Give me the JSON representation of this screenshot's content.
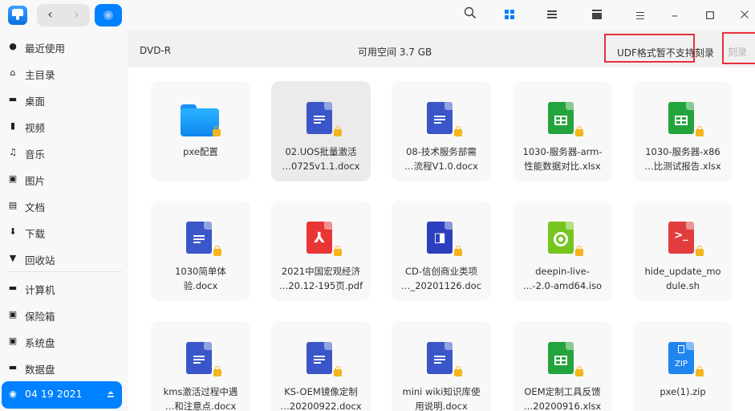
{
  "window": {
    "nav_back": "‹",
    "nav_forward": "›",
    "search_icon": "⌕",
    "minimize": "–",
    "maximize": "☐",
    "close": "✕"
  },
  "sidebar": {
    "items": [
      {
        "label": "最近使用",
        "icon": "clock-icon"
      },
      {
        "label": "主目录",
        "icon": "home-icon"
      },
      {
        "label": "桌面",
        "icon": "desktop-icon"
      },
      {
        "label": "视频",
        "icon": "video-icon"
      },
      {
        "label": "音乐",
        "icon": "music-icon"
      },
      {
        "label": "图片",
        "icon": "picture-icon"
      },
      {
        "label": "文档",
        "icon": "document-icon"
      },
      {
        "label": "下载",
        "icon": "download-icon"
      },
      {
        "label": "回收站",
        "icon": "trash-icon"
      },
      {
        "label": "计算机",
        "icon": "computer-icon"
      },
      {
        "label": "保险箱",
        "icon": "vault-icon"
      },
      {
        "label": "系统盘",
        "icon": "system-disk-icon"
      },
      {
        "label": "数据盘",
        "icon": "data-disk-icon"
      },
      {
        "label": "04 19 2021",
        "icon": "disc-icon"
      }
    ]
  },
  "infobar": {
    "disc_type": "DVD-R",
    "free_space": "可用空间 3.7 GB",
    "warning": "UDF格式暂不支持刻录",
    "burn_button": "刻录"
  },
  "files": [
    {
      "line1": "pxe配置",
      "line2": "",
      "type": "folder"
    },
    {
      "line1": "02.UOS批量激活",
      "line2": "…0725v1.1.docx",
      "type": "doc"
    },
    {
      "line1": "08-技术服务部需",
      "line2": "…流程V1.0.docx",
      "type": "doc"
    },
    {
      "line1": "1030-服务器-arm-",
      "line2": "性能数据对比.xlsx",
      "type": "xls"
    },
    {
      "line1": "1030-服务器-x86",
      "line2": "…比测试报告.xlsx",
      "type": "xls"
    },
    {
      "line1": "1030简单体",
      "line2": "验.docx",
      "type": "doc"
    },
    {
      "line1": "2021中国宏观经济",
      "line2": "…20.12-195页.pdf",
      "type": "pdf"
    },
    {
      "line1": "CD-信创商业类项",
      "line2": "…_20201126.doc",
      "type": "wps"
    },
    {
      "line1": "deepin-live-",
      "line2": "…-2.0-amd64.iso",
      "type": "iso"
    },
    {
      "line1": "hide_update_mo",
      "line2": "dule.sh",
      "type": "sh"
    },
    {
      "line1": "kms激活过程中遇",
      "line2": "…和注意点.docx",
      "type": "doc"
    },
    {
      "line1": "KS-OEM镜像定制",
      "line2": "…20200922.docx",
      "type": "doc"
    },
    {
      "line1": "mini wiki知识库使",
      "line2": "用说明.docx",
      "type": "doc"
    },
    {
      "line1": "OEM定制工具反馈",
      "line2": "…20200916.xlsx",
      "type": "xls"
    },
    {
      "line1": "pxe(1).zip",
      "line2": "",
      "type": "zip"
    }
  ],
  "colors": {
    "accent": "#0081ff",
    "warning_border": "#e8303c",
    "lock": "#f5b51d"
  }
}
